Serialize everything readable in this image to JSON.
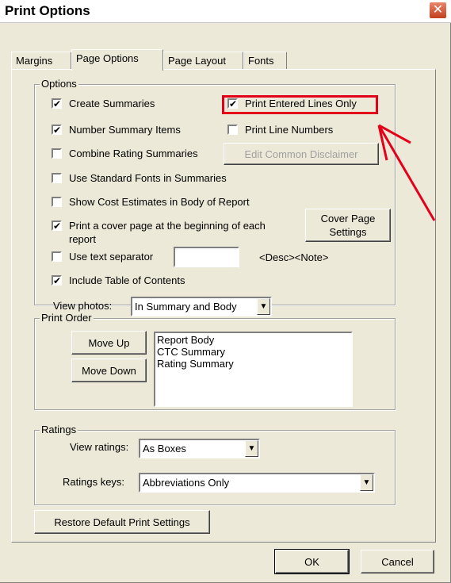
{
  "window": {
    "title": "Print Options",
    "close_glyph": "✕"
  },
  "tabs": [
    {
      "label": "Margins"
    },
    {
      "label": "Page Options"
    },
    {
      "label": "Page Layout"
    },
    {
      "label": "Fonts"
    }
  ],
  "options": {
    "group_label": "Options",
    "create_summaries": {
      "label": "Create Summaries",
      "checked": true
    },
    "print_entered_lines_only": {
      "label": "Print Entered Lines Only",
      "checked": true
    },
    "number_summary_items": {
      "label": "Number Summary Items",
      "checked": true
    },
    "print_line_numbers": {
      "label": "Print Line Numbers",
      "checked": false
    },
    "combine_rating_summaries": {
      "label": "Combine Rating Summaries",
      "checked": false
    },
    "edit_common_disclaimer_label": "Edit Common Disclaimer",
    "use_standard_fonts": {
      "label": "Use Standard Fonts in Summaries",
      "checked": false
    },
    "show_cost_estimates": {
      "label": "Show Cost Estimates in Body of Report",
      "checked": false
    },
    "print_cover_page": {
      "label_line1": "Print a cover page at the beginning of each",
      "label_line2": "report",
      "checked": true
    },
    "cover_page_settings_line1": "Cover Page",
    "cover_page_settings_line2": "Settings",
    "use_text_separator": {
      "label": "Use text separator",
      "checked": false
    },
    "text_separator_value": "",
    "desc_note_text": "<Desc><Note>",
    "include_toc": {
      "label": "Include Table of Contents",
      "checked": true
    },
    "view_photos_label": "View photos:",
    "view_photos_value": "In Summary and Body"
  },
  "print_order": {
    "group_label": "Print Order",
    "move_up_label": "Move Up",
    "move_down_label": "Move Down",
    "items": [
      "Report Body",
      "CTC Summary",
      "Rating Summary"
    ]
  },
  "ratings": {
    "group_label": "Ratings",
    "view_ratings_label": "View ratings:",
    "view_ratings_value": "As Boxes",
    "ratings_keys_label": "Ratings keys:",
    "ratings_keys_value": "Abbreviations Only"
  },
  "footer": {
    "restore_defaults_label": "Restore Default Print Settings",
    "ok_label": "OK",
    "cancel_label": "Cancel"
  },
  "colors": {
    "annotation_red": "#e4001b",
    "dialog_face": "#ece9d8"
  },
  "icons": {
    "check": "✔",
    "dropdown": "▼"
  }
}
